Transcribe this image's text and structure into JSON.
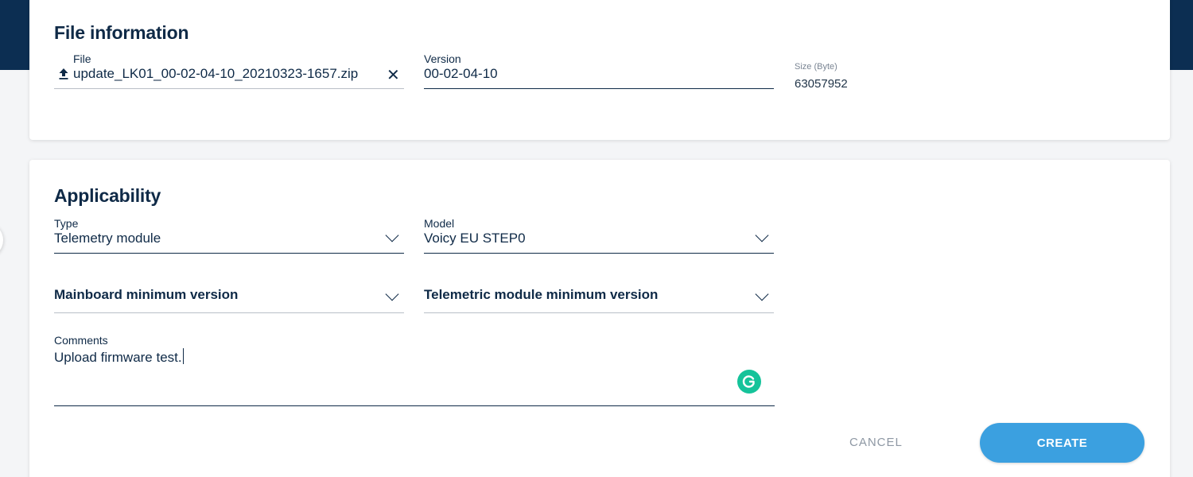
{
  "file_information": {
    "title": "File information",
    "file": {
      "label": "File",
      "value": "update_LK01_00-02-04-10_20210323-1657.zip",
      "upload_icon": "upload-icon",
      "clear_icon": "close-icon",
      "clear_glyph": "✕"
    },
    "version": {
      "label": "Version",
      "value": "00-02-04-10"
    },
    "size": {
      "label": "Size (Byte)",
      "value": "63057952"
    }
  },
  "applicability": {
    "title": "Applicability",
    "type": {
      "label": "Type",
      "value": "Telemetry module"
    },
    "model": {
      "label": "Model",
      "value": "Voicy EU STEP0"
    },
    "mainboard_min_version": {
      "label": "Mainboard minimum version",
      "value": ""
    },
    "telemetric_min_version": {
      "label": "Telemetric module minimum version",
      "value": ""
    },
    "comments": {
      "label": "Comments",
      "value": "Upload firmware test."
    }
  },
  "actions": {
    "cancel_label": "CANCEL",
    "create_label": "CREATE"
  },
  "colors": {
    "primary_navy": "#0f2a47",
    "header_band": "#0c2e52",
    "accent_blue": "#3ba0e0",
    "grammarly_green": "#15c39a",
    "muted_text": "#8e98a4"
  }
}
